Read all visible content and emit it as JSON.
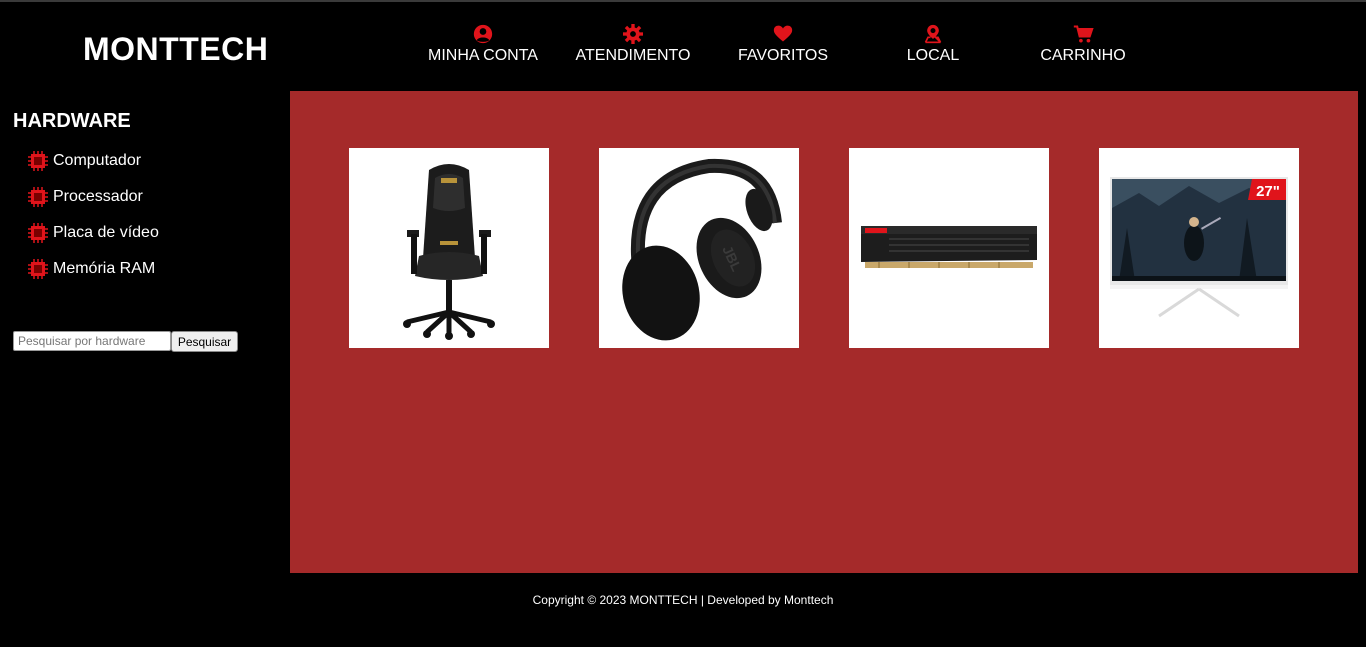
{
  "brand": "MONTTECH",
  "nav": [
    {
      "label": "MINHA CONTA",
      "icon": "user-icon"
    },
    {
      "label": "ATENDIMENTO",
      "icon": "gear-icon"
    },
    {
      "label": "FAVORITOS",
      "icon": "heart-icon"
    },
    {
      "label": "LOCAL",
      "icon": "map-pin-icon"
    },
    {
      "label": "CARRINHO",
      "icon": "cart-icon"
    }
  ],
  "sidebar": {
    "title": "HARDWARE",
    "items": [
      {
        "label": "Computador",
        "icon": "chip-icon"
      },
      {
        "label": "Processador",
        "icon": "chip-icon"
      },
      {
        "label": "Placa de vídeo",
        "icon": "chip-icon"
      },
      {
        "label": "Memória RAM",
        "icon": "chip-icon"
      }
    ],
    "search": {
      "placeholder": "Pesquisar por hardware",
      "value": "",
      "button_label": "Pesquisar"
    }
  },
  "products": [
    {
      "name": "gaming-chair-image"
    },
    {
      "name": "headphones-image"
    },
    {
      "name": "ram-memory-image"
    },
    {
      "name": "monitor-image",
      "badge": "27\""
    }
  ],
  "footer": {
    "text": "Copyright © 2023 MONTTECH | Developed by Monttech"
  },
  "colors": {
    "accent": "#e0141b",
    "main_bg": "#a52a2a",
    "page_bg": "#000000"
  }
}
